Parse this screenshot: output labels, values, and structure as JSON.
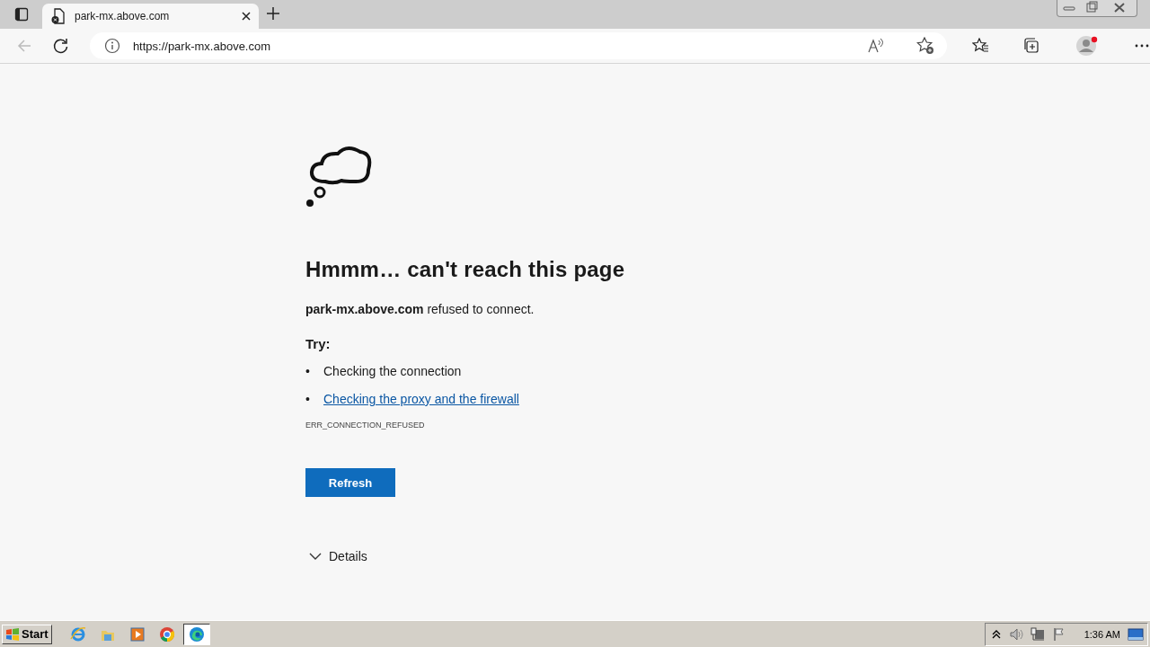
{
  "browser": {
    "tab": {
      "title": "park-mx.above.com",
      "selected": true
    },
    "address": {
      "value": "https://park-mx.above.com"
    },
    "profile": {
      "notification": true
    }
  },
  "page": {
    "heading": "Hmmm… can't reach this page",
    "message": "**park-mx.above.com** refused to connect.",
    "try_label": "Try:",
    "suggestions": [
      {
        "kind": "text",
        "marker": "•",
        "text": "Checking the connection"
      },
      {
        "kind": "link",
        "marker": "•",
        "text": "Checking the proxy and the firewall"
      }
    ],
    "error_code": "ERR_CONNECTION_REFUSED",
    "refresh_button": "Refresh",
    "details": {
      "label": "Details",
      "expanded": false
    }
  },
  "taskbar": {
    "start": "Start",
    "apps": [
      {
        "selected": false
      },
      {
        "selected": false
      },
      {
        "selected": false
      },
      {
        "selected": false
      },
      {
        "selected": true
      }
    ],
    "clock": "1:36 AM"
  }
}
